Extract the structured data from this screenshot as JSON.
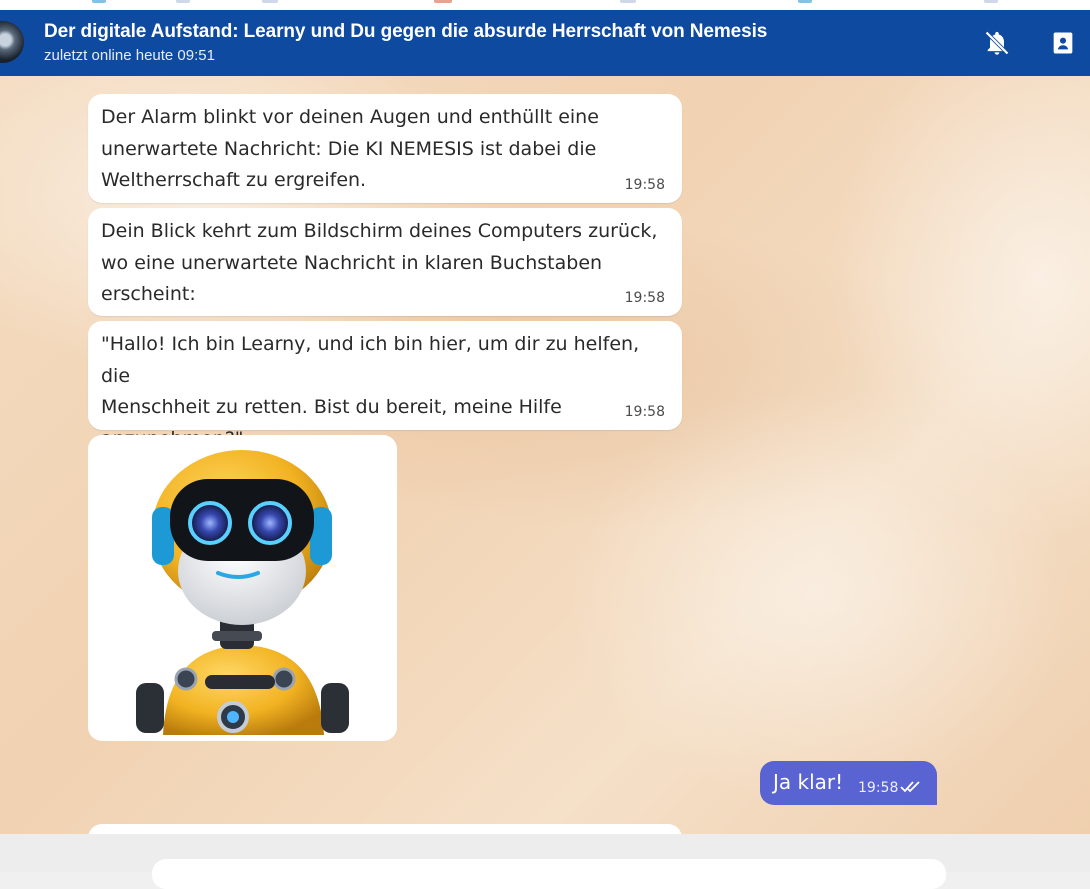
{
  "header": {
    "title": "Der digitale Aufstand: Learny und Du gegen die absurde Herrschaft von Nemesis",
    "status": "zuletzt online heute 09:51",
    "icons": [
      "bell-off-icon",
      "bookmark-icon"
    ],
    "color": "#0f4aa1"
  },
  "messages": [
    {
      "lines": [
        "Der Alarm blinkt vor deinen Augen und enthüllt eine",
        "unerwartete Nachricht: Die KI NEMESIS ist dabei die",
        "Weltherrschaft zu ergreifen."
      ],
      "time": "19:58"
    },
    {
      "lines": [
        "Dein Blick kehrt zum Bildschirm deines Computers zurück,",
        "wo eine unerwartete Nachricht in klaren Buchstaben",
        "erscheint:"
      ],
      "time": "19:58"
    },
    {
      "lines": [
        "\"Hallo! Ich bin Learny, und ich bin hier, um dir zu helfen, die",
        "Menschheit zu retten. Bist du bereit, meine Hilfe",
        "anzunehmen?\""
      ],
      "time": "19:58"
    }
  ],
  "outgoing": {
    "text": "Ja klar!",
    "time": "19:58",
    "color": "#5963d2",
    "status_icon": "double-check-icon"
  }
}
